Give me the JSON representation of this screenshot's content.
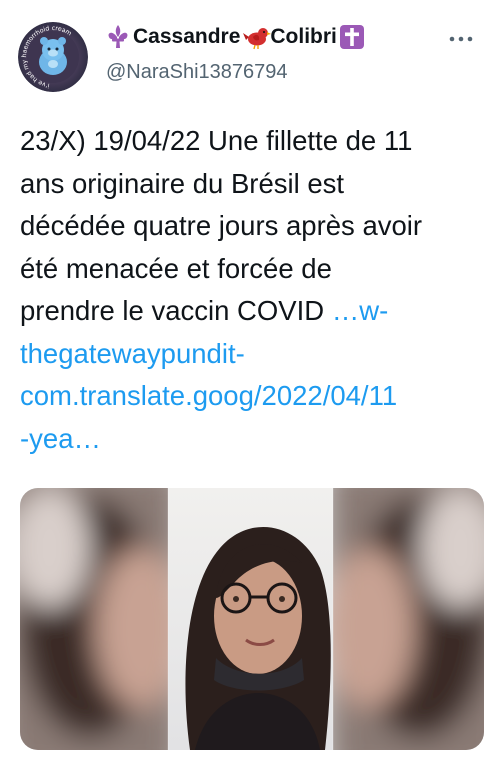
{
  "author": {
    "display_name": "Cassandre",
    "display_name_2": "Colibri",
    "handle": "@NaraShi13876794",
    "avatar_text": "i've had my haemorrhoid cream",
    "emojis": [
      "fleur-de-lis-icon",
      "bird-icon",
      "cross-icon"
    ]
  },
  "tweet": {
    "lines": [
      "23/X) 19/04/22 Une fillette de 11",
      "ans originaire du Brésil est",
      "décédée quatre jours après avoir",
      "été menacée et forcée de",
      "prendre le vaccin COVID "
    ],
    "link_part1": "…w-",
    "link_lines": [
      "thegatewaypundit-",
      "com.translate.goog/2022/04/11",
      "-yea…"
    ]
  },
  "media": {
    "type": "photo",
    "icon": "photo-icon"
  },
  "colors": {
    "accent": "#1d9bf0",
    "text": "#0f1419",
    "muted": "#536471",
    "emoji_purple": "#9b59b6",
    "emoji_red": "#d32f2f"
  }
}
